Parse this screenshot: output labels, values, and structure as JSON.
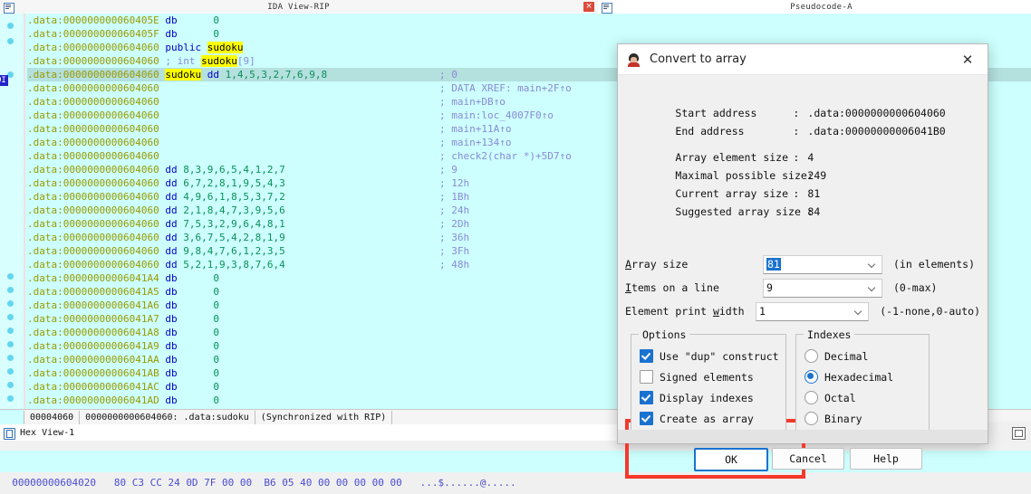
{
  "tabs": [
    {
      "label": "IDA View-RIP",
      "active": true,
      "icon": "document-icon",
      "close": "×"
    },
    {
      "label": "Pseudocode-A",
      "active": false,
      "icon": "document-icon"
    }
  ],
  "disassembly": {
    "rows": [
      {
        "addr": ".data:000000000060405E",
        "text": " db      0",
        "cmt": "",
        "cur": false,
        "kind": "db"
      },
      {
        "addr": ".data:000000000060405F",
        "text": " db      0",
        "cmt": "",
        "cur": false,
        "kind": "db"
      },
      {
        "addr": ".data:0000000000604060",
        "text": " public sudoku",
        "cmt": "",
        "cur": false,
        "kind": "public"
      },
      {
        "addr": ".data:0000000000604060",
        "text": " ; int sudoku[9]",
        "cmt": "",
        "cur": false,
        "kind": "decl"
      },
      {
        "addr": ".data:0000000000604060",
        "text": " sudoku dd 1,4,5,3,2,7,6,9,8",
        "cmt": "; 0",
        "cur": true,
        "kind": "array"
      },
      {
        "addr": ".data:0000000000604060",
        "text": "",
        "cmt": "; DATA XREF: main+2F↑o",
        "cur": false,
        "kind": "xref"
      },
      {
        "addr": ".data:0000000000604060",
        "text": "",
        "cmt": "; main+DB↑o",
        "cur": false,
        "kind": "xref"
      },
      {
        "addr": ".data:0000000000604060",
        "text": "",
        "cmt": "; main:loc_4007F0↑o",
        "cur": false,
        "kind": "xref"
      },
      {
        "addr": ".data:0000000000604060",
        "text": "",
        "cmt": "; main+11A↑o",
        "cur": false,
        "kind": "xref"
      },
      {
        "addr": ".data:0000000000604060",
        "text": "",
        "cmt": "; main+134↑o",
        "cur": false,
        "kind": "xref"
      },
      {
        "addr": ".data:0000000000604060",
        "text": "",
        "cmt": "; check2(char *)+5D7↑o",
        "cur": false,
        "kind": "xref"
      },
      {
        "addr": ".data:0000000000604060",
        "text": " dd 8,3,9,6,5,4,1,2,7",
        "cmt": "; 9",
        "cur": false,
        "kind": "dd"
      },
      {
        "addr": ".data:0000000000604060",
        "text": " dd 6,7,2,8,1,9,5,4,3",
        "cmt": "; 12h",
        "cur": false,
        "kind": "dd"
      },
      {
        "addr": ".data:0000000000604060",
        "text": " dd 4,9,6,1,8,5,3,7,2",
        "cmt": "; 1Bh",
        "cur": false,
        "kind": "dd"
      },
      {
        "addr": ".data:0000000000604060",
        "text": " dd 2,1,8,4,7,3,9,5,6",
        "cmt": "; 24h",
        "cur": false,
        "kind": "dd"
      },
      {
        "addr": ".data:0000000000604060",
        "text": " dd 7,5,3,2,9,6,4,8,1",
        "cmt": "; 2Dh",
        "cur": false,
        "kind": "dd"
      },
      {
        "addr": ".data:0000000000604060",
        "text": " dd 3,6,7,5,4,2,8,1,9",
        "cmt": "; 36h",
        "cur": false,
        "kind": "dd"
      },
      {
        "addr": ".data:0000000000604060",
        "text": " dd 9,8,4,7,6,1,2,3,5",
        "cmt": "; 3Fh",
        "cur": false,
        "kind": "dd"
      },
      {
        "addr": ".data:0000000000604060",
        "text": " dd 5,2,1,9,3,8,7,6,4",
        "cmt": "; 48h",
        "cur": false,
        "kind": "dd"
      },
      {
        "addr": ".data:00000000006041A4",
        "text": " db      0",
        "cmt": "",
        "cur": false,
        "kind": "db"
      },
      {
        "addr": ".data:00000000006041A5",
        "text": " db      0",
        "cmt": "",
        "cur": false,
        "kind": "db"
      },
      {
        "addr": ".data:00000000006041A6",
        "text": " db      0",
        "cmt": "",
        "cur": false,
        "kind": "db"
      },
      {
        "addr": ".data:00000000006041A7",
        "text": " db      0",
        "cmt": "",
        "cur": false,
        "kind": "db"
      },
      {
        "addr": ".data:00000000006041A8",
        "text": " db      0",
        "cmt": "",
        "cur": false,
        "kind": "db"
      },
      {
        "addr": ".data:00000000006041A9",
        "text": " db      0",
        "cmt": "",
        "cur": false,
        "kind": "db"
      },
      {
        "addr": ".data:00000000006041AA",
        "text": " db      0",
        "cmt": "",
        "cur": false,
        "kind": "db"
      },
      {
        "addr": ".data:00000000006041AB",
        "text": " db      0",
        "cmt": "",
        "cur": false,
        "kind": "db"
      },
      {
        "addr": ".data:00000000006041AC",
        "text": " db      0",
        "cmt": "",
        "cur": false,
        "kind": "db"
      },
      {
        "addr": ".data:00000000006041AD",
        "text": " db      0",
        "cmt": "",
        "cur": false,
        "kind": "db"
      }
    ],
    "register_marker": "OI"
  },
  "status_bar": {
    "offset": "00004060",
    "location": "0000000000604060: .data:sudoku",
    "sync": "(Synchronized with RIP)"
  },
  "hex_view": {
    "tab_label": "Hex View-1",
    "address": "00000000604020",
    "bytes_left": "80 C3 CC 24 0D 7F 00 00",
    "bytes_right": "B6 05 40 00 00 00 00 00",
    "ascii": "...$......@....."
  },
  "dialog": {
    "title": "Convert to array",
    "icon": "ida-logo-icon",
    "close_label": "✕",
    "info": [
      {
        "label": "Start address",
        "sep": ":",
        "value": ".data:0000000000604060"
      },
      {
        "label": "End address",
        "sep": ":",
        "value": ".data:00000000006041B0"
      }
    ],
    "sizes": [
      {
        "label": "Array element size",
        "sep": ":",
        "value": "4"
      },
      {
        "label": "Maximal possible size:",
        "sep": "",
        "value": "249"
      },
      {
        "label": "Current array size",
        "sep": ":",
        "value": "81"
      },
      {
        "label": "Suggested array size :",
        "sep": "",
        "value": "84"
      }
    ],
    "fields": [
      {
        "label": "Array size",
        "mnemonic": "A",
        "value": "81",
        "selected": true,
        "hint": "(in elements)"
      },
      {
        "label": "Items on a line",
        "mnemonic": "I",
        "value": "9",
        "selected": false,
        "hint": "(0-max)"
      },
      {
        "label": "Element print width",
        "mnemonic": "w",
        "value": "1",
        "selected": false,
        "hint": "(-1-none,0-auto)"
      }
    ],
    "options_group": {
      "title": "Options",
      "items": [
        {
          "label": "Use \"dup\" construct",
          "checked": true
        },
        {
          "label": "Signed elements",
          "checked": false
        },
        {
          "label": "Display indexes",
          "checked": true
        },
        {
          "label": "Create as array",
          "checked": true
        }
      ]
    },
    "indexes_group": {
      "title": "Indexes",
      "items": [
        {
          "label": "Decimal",
          "selected": false
        },
        {
          "label": "Hexadecimal",
          "selected": true
        },
        {
          "label": "Octal",
          "selected": false
        },
        {
          "label": "Binary",
          "selected": false
        }
      ]
    },
    "buttons": [
      {
        "label": "OK",
        "focused": true
      },
      {
        "label": "Cancel",
        "focused": false
      },
      {
        "label": "Help",
        "focused": false
      }
    ]
  },
  "annotation": {
    "color": "#f5392b",
    "shape": "rectangle"
  }
}
